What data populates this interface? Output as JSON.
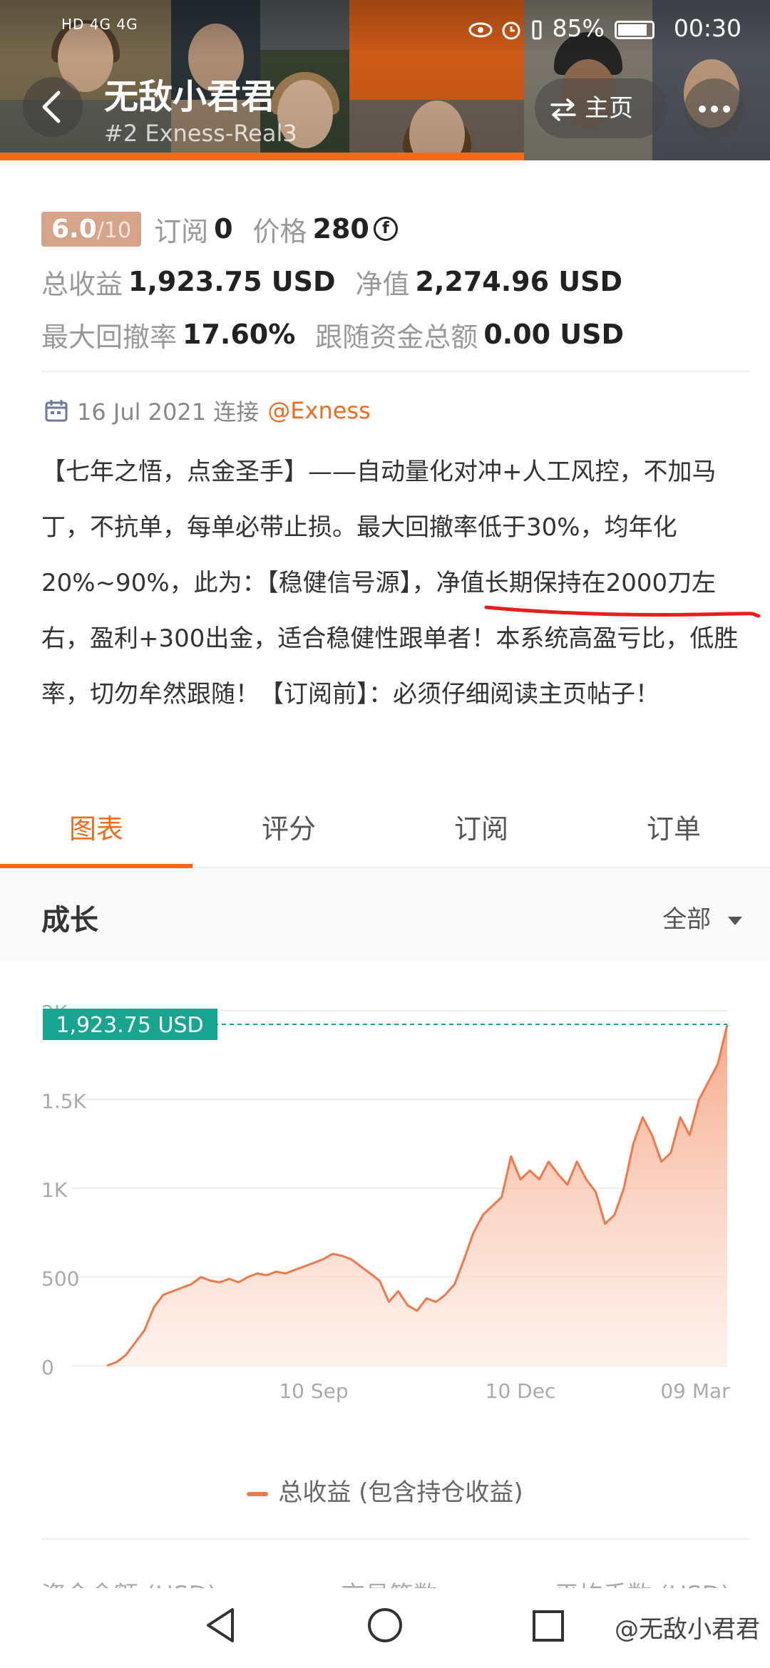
{
  "status_bar": {
    "network": "HD 4G 4G",
    "battery": "85%",
    "time": "00:30"
  },
  "header": {
    "title": "无敌小君君",
    "subtitle": "#2  Exness-Real3",
    "home_label": "主页",
    "back_icon": "chevron-left-icon",
    "more_icon": "more-dots-icon",
    "accent_color": "#f26a1b"
  },
  "stats": {
    "rating": "6.0",
    "rating_denominator": "/10",
    "subscribe_label": "订阅",
    "subscribe_value": "0",
    "price_label": "价格",
    "price_value": "280",
    "price_icon": "fx-coin-icon",
    "total_profit_label": "总收益",
    "total_profit_value": "1,923.75 USD",
    "equity_label": "净值",
    "equity_value": "2,274.96 USD",
    "max_drawdown_label": "最大回撤率",
    "max_drawdown_value": "17.60%",
    "follow_funds_label": "跟随资金总额",
    "follow_funds_value": "0.00 USD"
  },
  "connection": {
    "date": "16 Jul 2021 连接",
    "broker": "@Exness"
  },
  "description": {
    "part1": "【七年之悟，点金圣手】——自动量化对冲+人工风控，不加马丁，不抗单，每单必带止损。最大回撤率低于30%，均年化20%~90%，此为：【稳健信号源】，",
    "highlight": "净值长期保持在2000刀",
    "part2": "左右，盈利+300出金，适合稳健性跟单者！本系统高盈亏比，低胜率，切勿牟然跟随！【订阅前】：必须仔细阅读主页帖子！"
  },
  "tabs": [
    "图表",
    "评分",
    "订阅",
    "订单"
  ],
  "section": {
    "title": "成长",
    "filter": "全部"
  },
  "chart_data": {
    "type": "area",
    "current_label": "1,923.75 USD",
    "current_value": 1923.75,
    "ylim": [
      0,
      2000
    ],
    "y_ticks": [
      "0",
      "500",
      "1K",
      "1.5K",
      "2K"
    ],
    "y_tick_values": [
      0,
      500,
      1000,
      1500,
      2000
    ],
    "x_ticks": [
      "10 Sep",
      "10 Dec",
      "09 Mar"
    ],
    "legend": "总收益 (包含持仓收益)",
    "color": "#f2784b",
    "series": [
      {
        "values": [
          0,
          20,
          60,
          130,
          200,
          330,
          400,
          420,
          440,
          460,
          500,
          480,
          470,
          490,
          470,
          500,
          520,
          510,
          530,
          520,
          540,
          560,
          580,
          600,
          630,
          620,
          600,
          560,
          520,
          480,
          360,
          420,
          340,
          310,
          380,
          360,
          400,
          460,
          600,
          750,
          850,
          900,
          950,
          1180,
          1050,
          1100,
          1050,
          1150,
          1080,
          1020,
          1150,
          1050,
          980,
          800,
          850,
          1000,
          1250,
          1400,
          1300,
          1150,
          1200,
          1400,
          1300,
          1500,
          1600,
          1700,
          1920
        ]
      }
    ]
  },
  "footer": {
    "cutoff_labels": [
      "资金余额 (USD)",
      "交易笔数",
      "平均手数 (USD)"
    ],
    "watermark": "@无敌小君君"
  }
}
